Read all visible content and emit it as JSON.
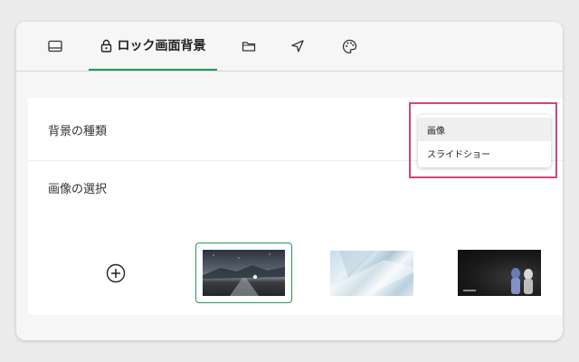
{
  "tabs": {
    "items": [
      {
        "icon": "display-icon",
        "label": ""
      },
      {
        "icon": "lock-icon",
        "label": "ロック画面背景",
        "active": true
      },
      {
        "icon": "folder-icon",
        "label": ""
      },
      {
        "icon": "navigation-arrow-icon",
        "label": ""
      },
      {
        "icon": "palette-icon",
        "label": ""
      }
    ],
    "active_label": "ロック画面背景",
    "accent_color": "#1e9c57"
  },
  "settings": {
    "background_type_label": "背景の種類",
    "image_select_label": "画像の選択"
  },
  "dropdown": {
    "options": [
      "画像",
      "スライドショー"
    ],
    "selected": "画像",
    "highlight_color": "#d0457a"
  },
  "thumbnails": {
    "add_icon": "plus-circle-icon",
    "items": [
      {
        "name": "night-road-wallpaper",
        "selected": true
      },
      {
        "name": "light-blue-abstract-wallpaper",
        "selected": false
      },
      {
        "name": "dark-characters-wallpaper",
        "selected": false
      }
    ]
  }
}
